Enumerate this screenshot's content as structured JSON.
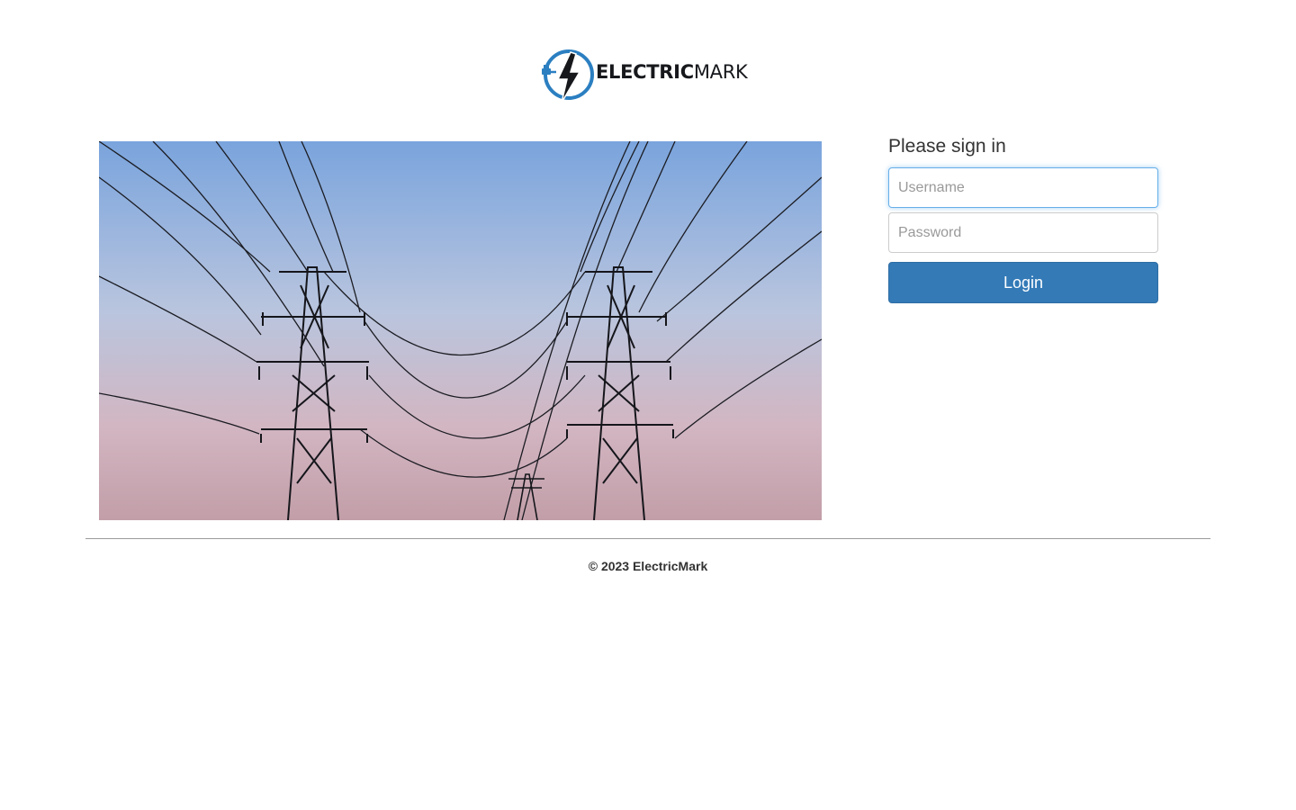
{
  "logo": {
    "word_bold": "ELECTRIC",
    "word_regular": "MARK",
    "icon": "lightning-plug-icon",
    "accent_color": "#2b7fc1"
  },
  "hero": {
    "image": "transmission-towers-photo"
  },
  "signin": {
    "heading": "Please sign in",
    "username_placeholder": "Username",
    "password_placeholder": "Password",
    "login_label": "Login",
    "button_color": "#337ab7"
  },
  "footer": {
    "text": "© 2023 ElectricMark"
  }
}
